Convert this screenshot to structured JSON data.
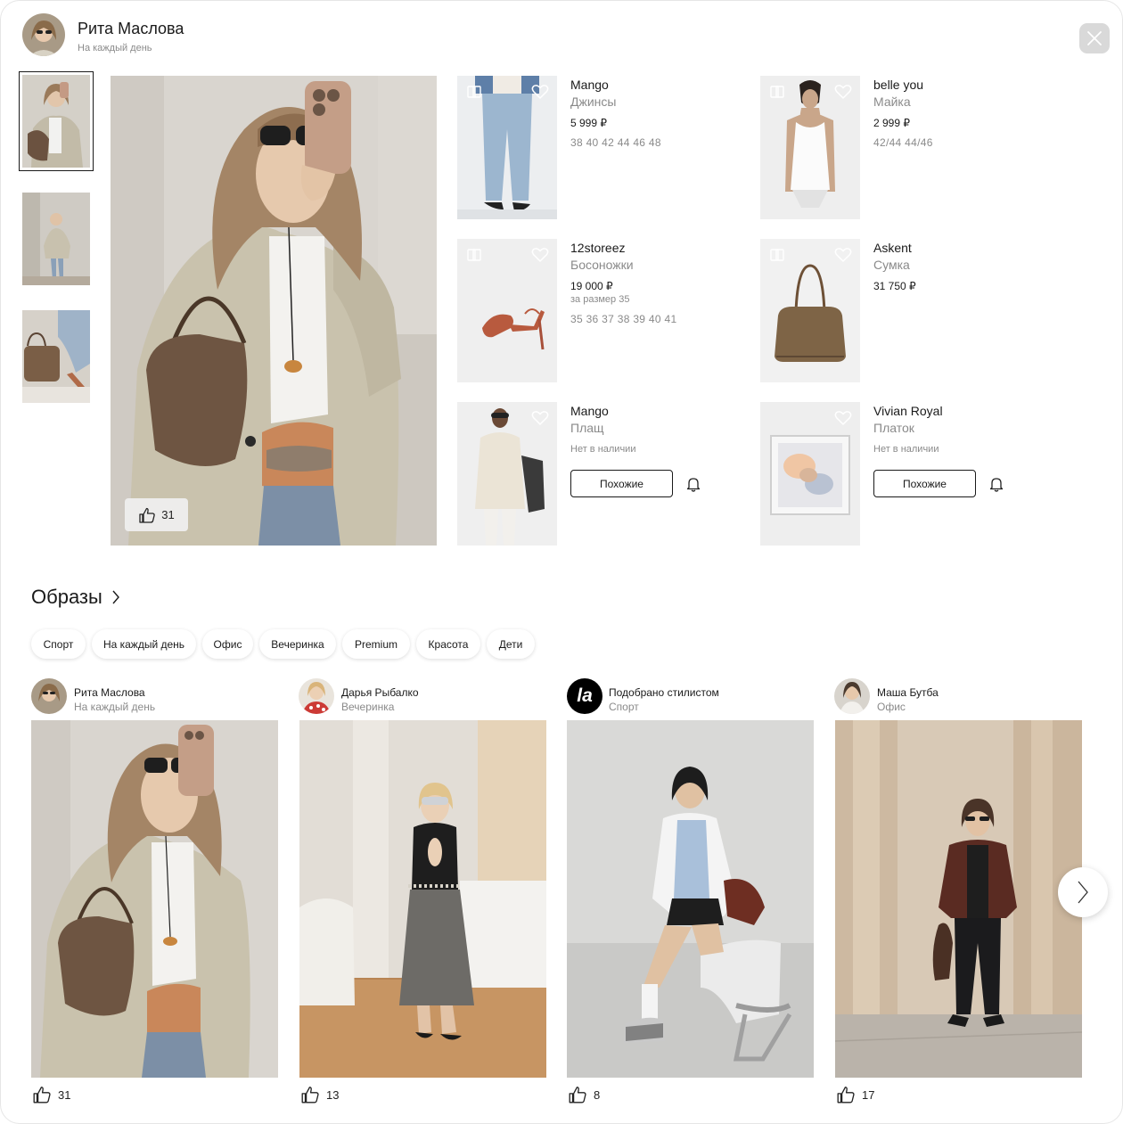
{
  "header": {
    "name": "Рита Маслова",
    "subtitle": "На каждый день"
  },
  "main_photo": {
    "likes": "31"
  },
  "products": [
    {
      "brand": "Mango",
      "type": "Джинсы",
      "price": "5 999 ₽",
      "sizes": "38 40 42 44 46 48"
    },
    {
      "brand": "belle you",
      "type": "Майка",
      "price": "2 999 ₽",
      "sizes": "42/44 44/46"
    },
    {
      "brand": "12storeez",
      "type": "Босоножки",
      "price": "19 000 ₽",
      "note": "за размер 35",
      "sizes": "35 36 37 38 39 40 41"
    },
    {
      "brand": "Askent",
      "type": "Сумка",
      "price": "31 750 ₽"
    },
    {
      "brand": "Mango",
      "type": "Плащ",
      "status": "Нет в наличии",
      "button": "Похожие"
    },
    {
      "brand": "Vivian Royal",
      "type": "Платок",
      "status": "Нет в наличии",
      "button": "Похожие"
    }
  ],
  "looks_section": {
    "title": "Образы",
    "chips": [
      "Спорт",
      "На каждый день",
      "Офис",
      "Вечеринка",
      "Premium",
      "Красота",
      "Дети"
    ],
    "cards": [
      {
        "author": "Рита Маслова",
        "category": "На каждый день",
        "likes": "31"
      },
      {
        "author": "Дарья Рыбалко",
        "category": "Вечеринка",
        "likes": "13"
      },
      {
        "author": "Подобрано стилистом",
        "category": "Спорт",
        "likes": "8",
        "badge": "la"
      },
      {
        "author": "Маша Бутба",
        "category": "Офис",
        "likes": "17"
      }
    ]
  },
  "icons": {
    "close": "close-icon",
    "like": "thumbs-up-icon",
    "favorite": "heart-icon",
    "cards": "cards-icon",
    "notify": "bell-icon",
    "chevron": "chevron-right-icon"
  }
}
